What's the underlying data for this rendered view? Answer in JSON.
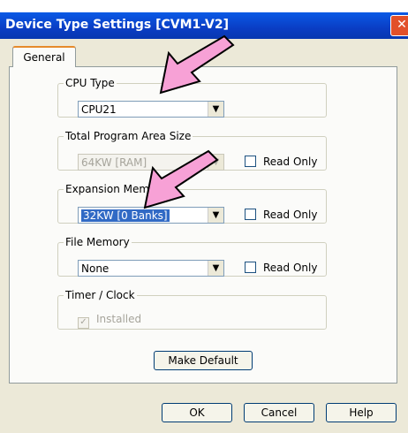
{
  "window": {
    "title": "Device Type Settings [CVM1-V2]",
    "close_glyph": "✕"
  },
  "tabs": [
    {
      "label": "General"
    }
  ],
  "cpu_type": {
    "legend": "CPU Type",
    "value": "CPU21"
  },
  "program_area": {
    "legend": "Total Program Area Size",
    "value": "64KW [RAM]",
    "read_only_label": "Read Only"
  },
  "expansion_memory": {
    "legend": "Expansion Mem",
    "value": "32KW [0 Banks]",
    "read_only_label": "Read Only"
  },
  "file_memory": {
    "legend": "File Memory",
    "value": "None",
    "read_only_label": "Read Only"
  },
  "timer_clock": {
    "legend": "Timer / Clock",
    "installed_label": "Installed",
    "installed_checked": true
  },
  "buttons": {
    "make_default": "Make Default",
    "ok": "OK",
    "cancel": "Cancel",
    "help": "Help"
  },
  "colors": {
    "title_bar": "#0a3dc4",
    "highlight": "#316ac5",
    "annotation_arrow": "#f7a1d6"
  },
  "icons": {
    "dropdown": "▼",
    "checkmark": "✓"
  }
}
